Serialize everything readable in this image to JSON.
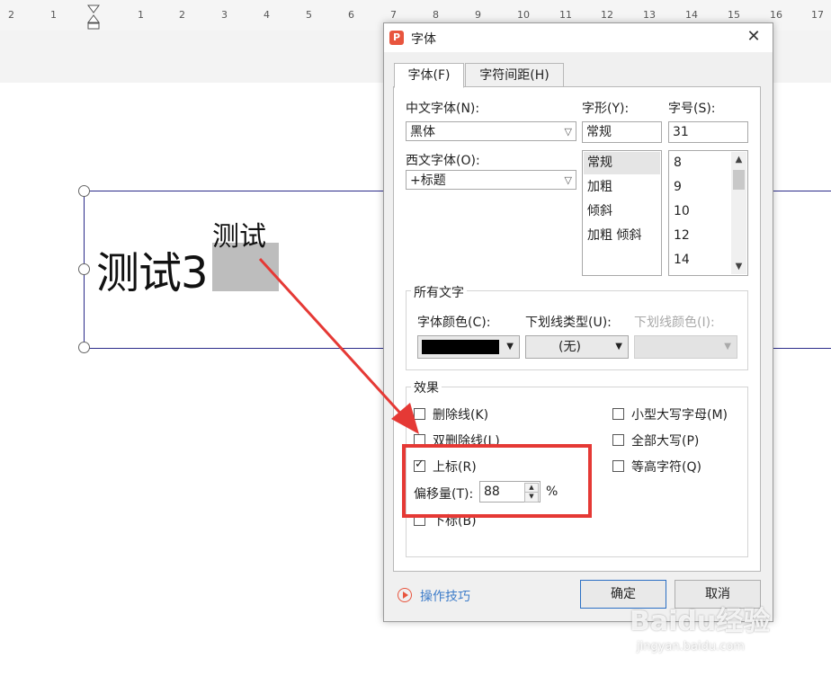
{
  "ruler": {
    "numbers": [
      "2",
      "1",
      "1",
      "2",
      "3",
      "4",
      "5",
      "6",
      "7",
      "8",
      "9",
      "10",
      "11",
      "12",
      "13",
      "14",
      "15",
      "16",
      "17"
    ]
  },
  "document": {
    "main_text": "测试3",
    "superscript_text": "测试"
  },
  "dialog": {
    "title": "字体",
    "logo_letter": "P",
    "close": "✕",
    "tabs": [
      {
        "label": "字体(F)",
        "active": true
      },
      {
        "label": "字符间距(H)",
        "active": false
      }
    ],
    "chinese_font": {
      "label": "中文字体(N):",
      "value": "黑体"
    },
    "western_font": {
      "label": "西文字体(O):",
      "value": "+标题"
    },
    "style": {
      "label": "字形(Y):",
      "value": "常规",
      "options": [
        "常规",
        "加粗",
        "倾斜",
        "加粗 倾斜"
      ],
      "selected": "常规"
    },
    "size": {
      "label": "字号(S):",
      "value": "31",
      "options": [
        "8",
        "9",
        "10",
        "12",
        "14"
      ]
    },
    "all_text": {
      "title": "所有文字",
      "font_color": {
        "label": "字体颜色(C):",
        "value_color": "#000000"
      },
      "underline_type": {
        "label": "下划线类型(U):",
        "value": "(无)"
      },
      "underline_color": {
        "label": "下划线颜色(I):",
        "enabled": false
      }
    },
    "effects": {
      "title": "效果",
      "left": [
        {
          "label": "删除线(K)",
          "checked": false
        },
        {
          "label": "双删除线(L)",
          "checked": false
        },
        {
          "label": "上标(R)",
          "checked": true
        },
        {
          "label": "下标(B)",
          "checked": false
        }
      ],
      "right": [
        {
          "label": "小型大写字母(M)",
          "checked": false
        },
        {
          "label": "全部大写(P)",
          "checked": false
        },
        {
          "label": "等高字符(Q)",
          "checked": false
        }
      ],
      "offset": {
        "label": "偏移量(T):",
        "value": "88",
        "unit": "%"
      }
    },
    "tips": "操作技巧",
    "ok": "确定",
    "cancel": "取消"
  },
  "watermark": {
    "main": "Baidu经验",
    "sub": "jingyan.baidu.com"
  },
  "colors": {
    "annotation": "#e53935",
    "accent": "#2b6fc4",
    "link": "#3d7cc9"
  }
}
